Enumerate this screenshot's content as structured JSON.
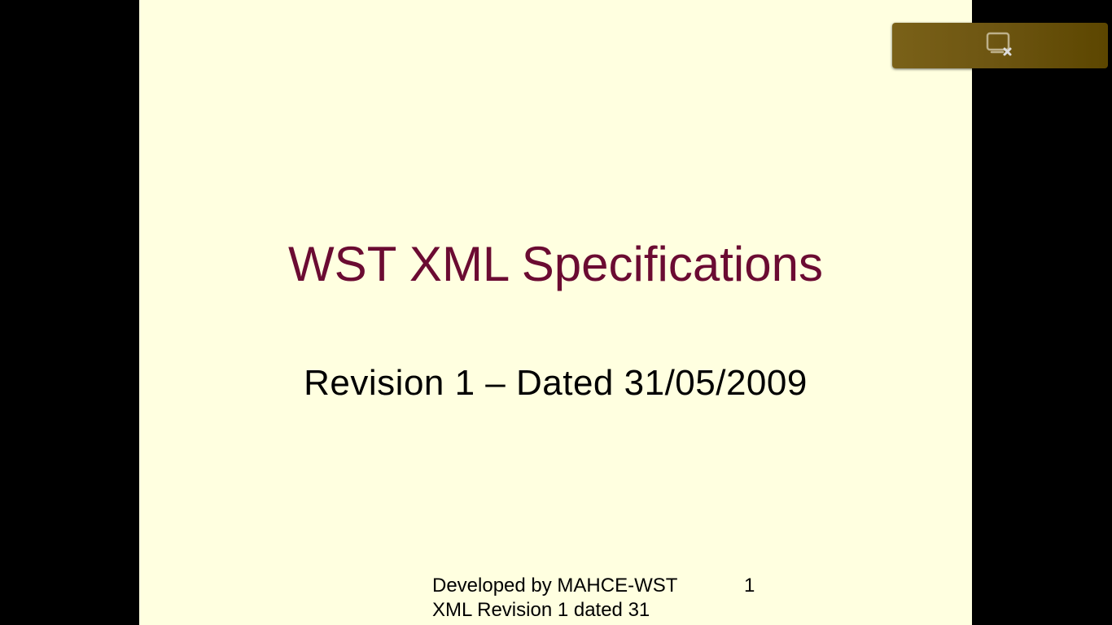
{
  "slide": {
    "title": "WST XML Specifications",
    "subtitle": "Revision 1 – Dated 31/05/2009",
    "footer_line1": "Developed by MAHCE-WST",
    "footer_line2": "XML Revision 1 dated 31",
    "slide_number": "1"
  },
  "toolbar": {
    "exit_icon": "exit-presentation-icon"
  },
  "colors": {
    "slide_background": "#ffffe0",
    "title_color": "#6b0b32",
    "toolbar_color": "#6e5612"
  }
}
